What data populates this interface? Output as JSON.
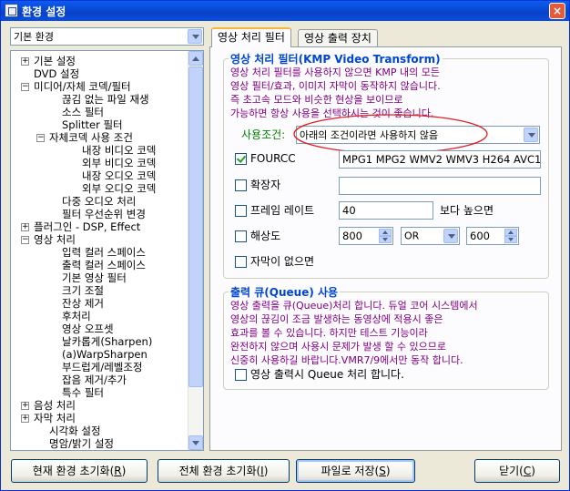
{
  "window": {
    "title": "환경 설정",
    "close_glyph": "×"
  },
  "preset_combo": {
    "value": "기본 환경"
  },
  "tree": {
    "items": [
      {
        "label": "기본 설정",
        "expander": "+"
      },
      {
        "label": "DVD 설정",
        "expander": ""
      },
      {
        "label": "미디어/자체 코덱/필터",
        "expander": "−"
      },
      {
        "label": "끊김 없는 파일 재생",
        "expander": ""
      },
      {
        "label": "소스 필터",
        "expander": ""
      },
      {
        "label": "Splitter 필터",
        "expander": ""
      },
      {
        "label": "자체코덱 사용 조건",
        "expander": "−"
      },
      {
        "label": "내장 비디오 코덱",
        "expander": ""
      },
      {
        "label": "외부 비디오 코덱",
        "expander": ""
      },
      {
        "label": "내장 오디오 코덱",
        "expander": ""
      },
      {
        "label": "외부 오디오 코덱",
        "expander": ""
      },
      {
        "label": "다중 오디오 처리",
        "expander": ""
      },
      {
        "label": "필터 우선순위 변경",
        "expander": ""
      },
      {
        "label": "플러그인 - DSP, Effect",
        "expander": "+"
      },
      {
        "label": "영상 처리",
        "expander": "−"
      },
      {
        "label": "입력 컬러 스페이스",
        "expander": ""
      },
      {
        "label": "출력 컬러 스페이스",
        "expander": ""
      },
      {
        "label": "기본 영상 필터",
        "expander": ""
      },
      {
        "label": "크기 조절",
        "expander": ""
      },
      {
        "label": "잔상 제거",
        "expander": ""
      },
      {
        "label": "후처리",
        "expander": ""
      },
      {
        "label": "영상 오프셋",
        "expander": ""
      },
      {
        "label": "날카롭게(Sharpen)",
        "expander": ""
      },
      {
        "label": "(a)WarpSharpen",
        "expander": ""
      },
      {
        "label": "부드럽게/레벨조정",
        "expander": ""
      },
      {
        "label": "잡음 제거/추가",
        "expander": ""
      },
      {
        "label": "특수 필터",
        "expander": ""
      },
      {
        "label": "음성 처리",
        "expander": "+"
      },
      {
        "label": "자막 처리",
        "expander": "+"
      },
      {
        "label": "시각화 설정",
        "expander": ""
      },
      {
        "label": "명암/밝기 설정",
        "expander": ""
      }
    ]
  },
  "tabs": [
    {
      "label": "영상 처리 필터"
    },
    {
      "label": "영상 출력 장치"
    }
  ],
  "filter_group": {
    "title": "영상 처리 필터(KMP Video Transform)",
    "description": "영상 처리 필터를 사용하지 않으면 KMP 내의 모든\n영상 필터/효과, 이미지 자막이 동작하지 않습니다.\n즉 초고속 모드와 비슷한 현상을 보이므로\n가능하면 항상 사용을 선택하시는 것이 좋습니다.",
    "usage_label": "사용조건:",
    "usage_value": "아래의 조건이라면 사용하지 않음",
    "fourcc": {
      "label": "FOURCC",
      "checked": true,
      "value": "MPG1 MPG2 WMV2 WMV3 H264 AVC1"
    },
    "extension": {
      "label": "확장자",
      "checked": false,
      "value": ""
    },
    "framerate": {
      "label": "프레임 레이트",
      "checked": false,
      "value": "40",
      "suffix": "보다 높으면"
    },
    "resolution": {
      "label": "해상도",
      "checked": false,
      "width": "800",
      "op": "OR",
      "height": "600"
    },
    "no_subtitle": {
      "label": "자막이 없으면",
      "checked": false
    }
  },
  "queue_group": {
    "title": "출력 큐(Queue) 사용",
    "description": "영상 출력을 큐(Queue)처리 합니다. 듀얼 코어 시스템에서\n영상의 끊김이 조금 발생하는 동영상에 적용시 좋은\n효과를 볼 수 있습니다. 하지만 테스트 기능이라\n완전하지 않으며 사용시 문제가 발생 할 수 있으므로\n신중히 사용하길 바랍니다.VMR7/9에서만 동작 합니다.",
    "checkbox_label": "영상 출력시 Queue 처리 합니다."
  },
  "buttons": {
    "reset_current": {
      "label": "현재 환경 초기화(",
      "key": "R",
      "end": ")"
    },
    "reset_all": {
      "label": "전체 환경 초기화(",
      "key": "I",
      "end": ")"
    },
    "save_file": {
      "label": "파일로 저장(",
      "key": "S",
      "end": ")"
    },
    "close": {
      "label": "닫기(",
      "key": "C",
      "end": ")"
    }
  },
  "colors": {
    "group_title": "#0046d5",
    "description": "#800080",
    "usage_label": "#008000",
    "highlight_ellipse": "#e02020"
  }
}
